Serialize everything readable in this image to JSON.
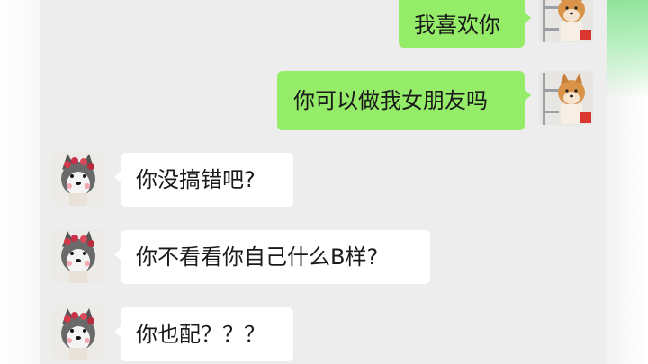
{
  "chat": {
    "messages": [
      {
        "sender": "self",
        "text": "我喜欢你"
      },
      {
        "sender": "self",
        "text": "你可以做我女朋友吗"
      },
      {
        "sender": "other",
        "text": "你没搞错吧?"
      },
      {
        "sender": "other",
        "text": "你不看看你自己什么B样?"
      },
      {
        "sender": "other",
        "text": "你也配？？？"
      }
    ]
  },
  "avatars": {
    "self": "shiba-dog-avatar-icon",
    "other": "husky-dog-with-flowers-avatar-icon"
  },
  "colors": {
    "chat_background": "#ededed",
    "sent_bubble": "#95ec69",
    "received_bubble": "#ffffff",
    "text": "#1a1a1a"
  }
}
